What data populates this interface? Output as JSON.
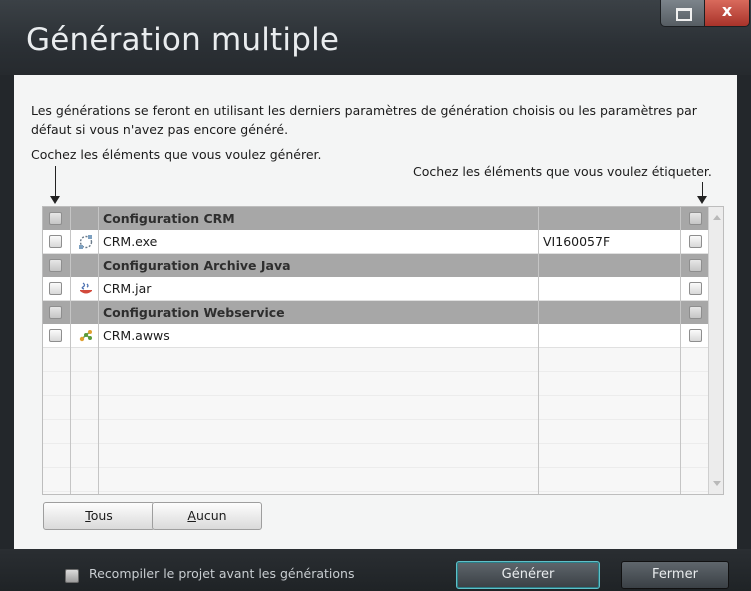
{
  "window": {
    "title": "Génération multiple",
    "controls": {
      "maximize_icon": "maximize-icon",
      "close_symbol": "x"
    }
  },
  "intro": {
    "text": "Les générations se feront en utilisant les derniers paramètres de génération choisis ou les paramètres par défaut si vous n'avez pas encore généré."
  },
  "hints": {
    "left": "Cochez les éléments que vous voulez générer.",
    "right": "Cochez les éléments que vous voulez étiqueter."
  },
  "grid": {
    "rows": [
      {
        "type": "group",
        "label": "Configuration CRM",
        "version": ""
      },
      {
        "type": "item",
        "icon": "exe-icon",
        "label": "CRM.exe",
        "version": "VI160057F"
      },
      {
        "type": "group",
        "label": "Configuration Archive Java",
        "version": ""
      },
      {
        "type": "item",
        "icon": "java-jar-icon",
        "label": "CRM.jar",
        "version": ""
      },
      {
        "type": "group",
        "label": "Configuration Webservice",
        "version": ""
      },
      {
        "type": "item",
        "icon": "webservice-icon",
        "label": "CRM.awws",
        "version": ""
      }
    ]
  },
  "buttons": {
    "all_prefix": "T",
    "all_rest": "ous",
    "none_prefix": "A",
    "none_rest": "ucun"
  },
  "footer": {
    "recompile_label": "Recompiler le projet avant les générations",
    "generate_label": "Générer",
    "close_label": "Fermer"
  },
  "colors": {
    "titlebar": "#2b3035",
    "group_row": "#a7a7a7",
    "primary_border": "#5fc0c8",
    "close_button": "#c0483c"
  }
}
